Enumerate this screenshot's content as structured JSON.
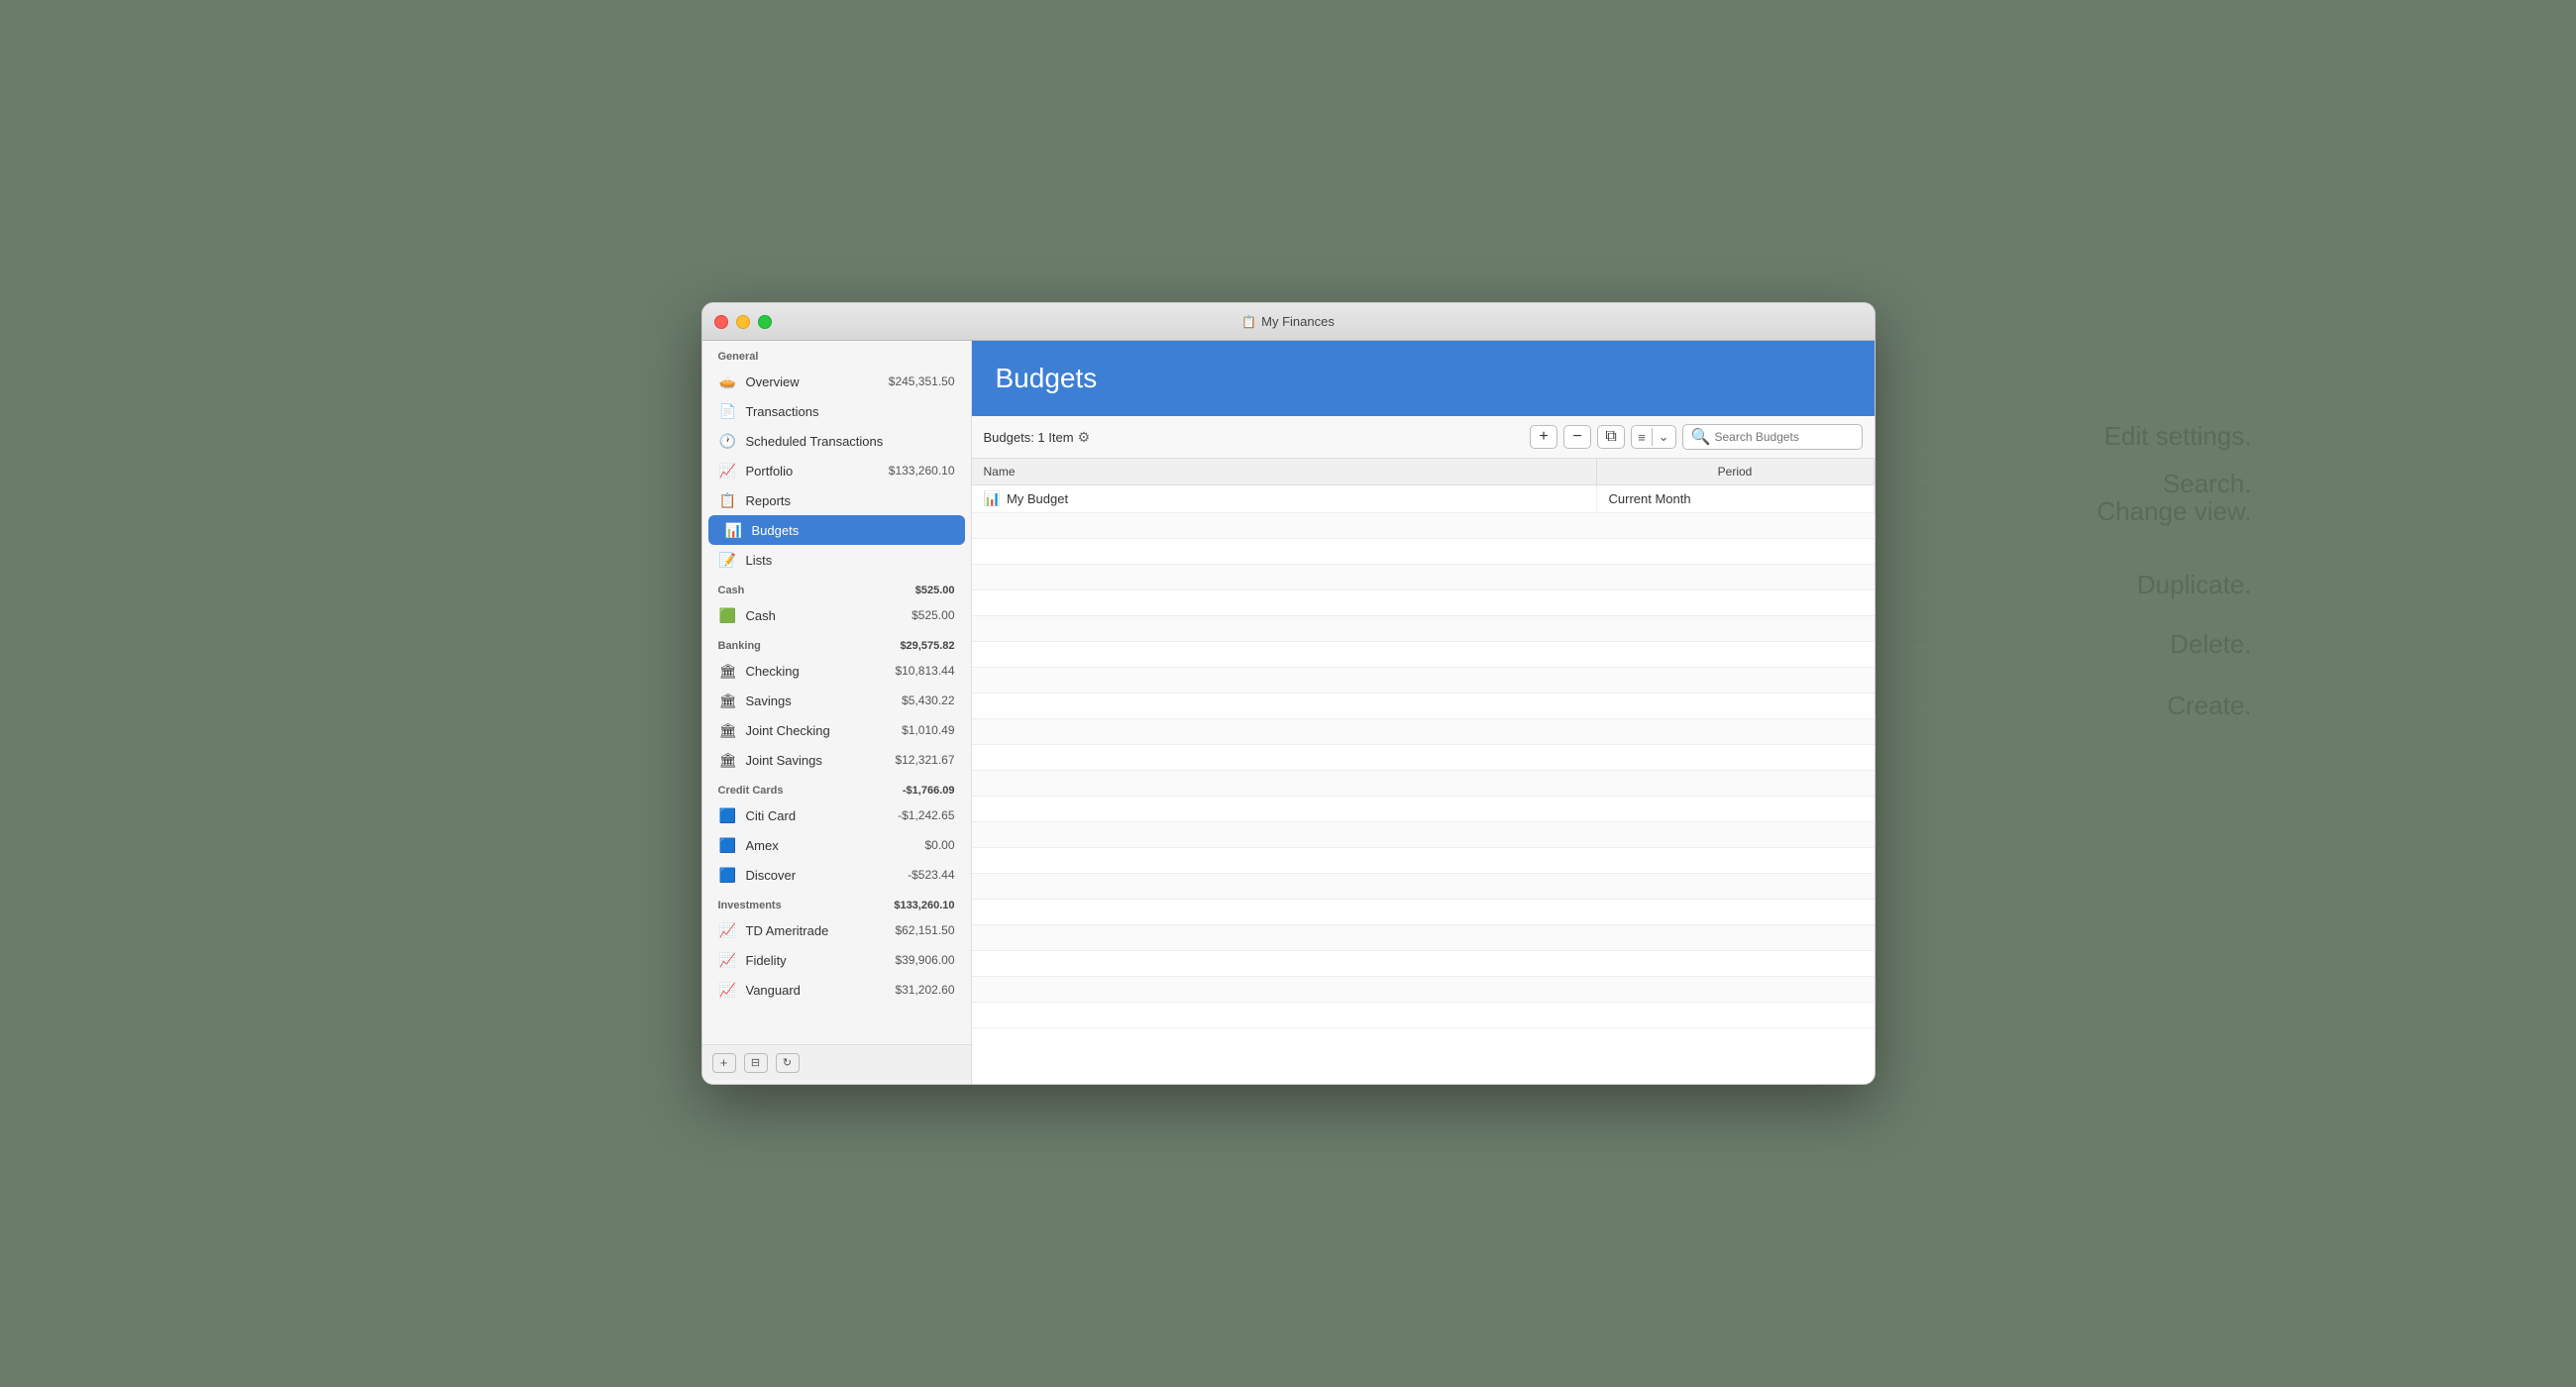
{
  "window": {
    "title": "My Finances",
    "title_icon": "📋"
  },
  "sidebar": {
    "general_label": "General",
    "overview_label": "Overview",
    "overview_amount": "$245,351.50",
    "transactions_label": "Transactions",
    "scheduled_label": "Scheduled Transactions",
    "portfolio_label": "Portfolio",
    "portfolio_amount": "$133,260.10",
    "reports_label": "Reports",
    "budgets_label": "Budgets",
    "lists_label": "Lists",
    "cash_label": "Cash",
    "cash_total": "$525.00",
    "cash_item_label": "Cash",
    "cash_item_amount": "$525.00",
    "banking_label": "Banking",
    "banking_total": "$29,575.82",
    "checking_label": "Checking",
    "checking_amount": "$10,813.44",
    "savings_label": "Savings",
    "savings_amount": "$5,430.22",
    "joint_checking_label": "Joint Checking",
    "joint_checking_amount": "$1,010.49",
    "joint_savings_label": "Joint Savings",
    "joint_savings_amount": "$12,321.67",
    "credit_label": "Credit Cards",
    "credit_total": "-$1,766.09",
    "citi_label": "Citi Card",
    "citi_amount": "-$1,242.65",
    "amex_label": "Amex",
    "amex_amount": "$0.00",
    "discover_label": "Discover",
    "discover_amount": "-$523.44",
    "investments_label": "Investments",
    "investments_total": "$133,260.10",
    "td_label": "TD Ameritrade",
    "td_amount": "$62,151.50",
    "fidelity_label": "Fidelity",
    "fidelity_amount": "$39,906.00",
    "vanguard_label": "Vanguard",
    "vanguard_amount": "$31,202.60"
  },
  "panel": {
    "title": "Budgets",
    "toolbar": {
      "info": "Budgets: 1 Item",
      "search_placeholder": "Search Budgets",
      "add_label": "+",
      "remove_label": "−",
      "duplicate_label": "⧉",
      "view_label": "≡",
      "sort_label": "⌄"
    },
    "table": {
      "col_name": "Name",
      "col_period": "Period",
      "rows": [
        {
          "name": "My Budget",
          "period": "Current Month",
          "icon": "📊"
        }
      ]
    }
  },
  "annotations": {
    "edit_settings": "Edit\nsettings.",
    "search": "Search.",
    "change_view": "Change\nview.",
    "duplicate": "Duplicate.",
    "delete": "Delete.",
    "create": "Create."
  }
}
